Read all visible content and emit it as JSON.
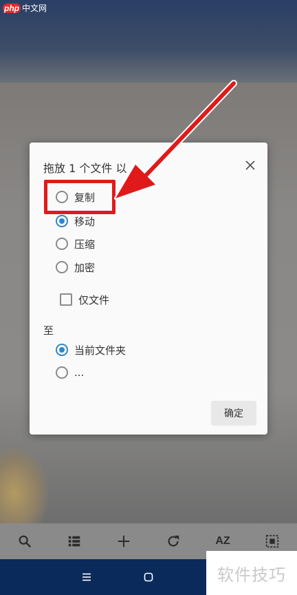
{
  "watermark": {
    "php": "php",
    "site": "中文网",
    "bottom": "软件技巧"
  },
  "dialog": {
    "title": "拖放 1 个文件 以",
    "operations": [
      {
        "label": "复制",
        "selected": false
      },
      {
        "label": "移动",
        "selected": true
      },
      {
        "label": "压缩",
        "selected": false
      },
      {
        "label": "加密",
        "selected": false
      }
    ],
    "files_only": {
      "label": "仅文件",
      "checked": false
    },
    "destination_heading": "至",
    "destinations": [
      {
        "label": "当前文件夹",
        "selected": true
      },
      {
        "label": "...",
        "selected": false
      }
    ],
    "confirm_label": "确定"
  },
  "toolbar": {
    "icons": [
      "search-icon",
      "list-view-icon",
      "add-icon",
      "refresh-icon",
      "sort-az-icon",
      "select-all-icon"
    ],
    "sort_label": "AZ"
  },
  "navbar": {
    "icons": [
      "menu-icon",
      "home-icon"
    ]
  },
  "colors": {
    "accent": "#2f86c8",
    "highlight": "#e01a1a",
    "navbar": "#0a2a5c"
  }
}
